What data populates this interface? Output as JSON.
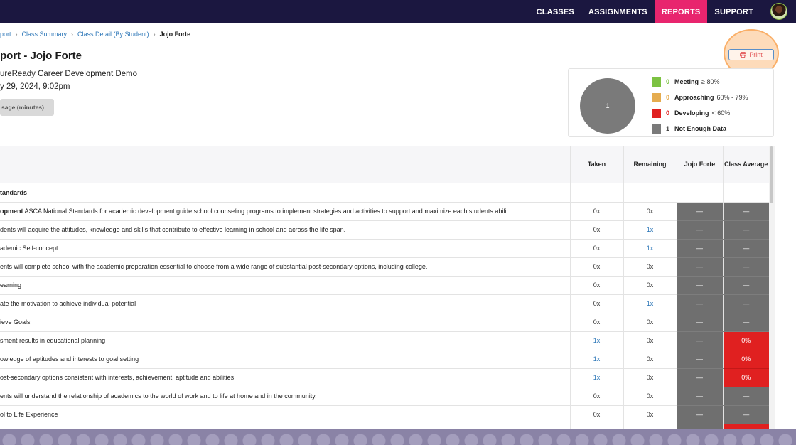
{
  "nav": {
    "items": [
      {
        "label": "CLASSES",
        "active": false
      },
      {
        "label": "ASSIGNMENTS",
        "active": false
      },
      {
        "label": "REPORTS",
        "active": true
      },
      {
        "label": "SUPPORT",
        "active": false
      }
    ],
    "active_color": "#e8256e",
    "bg_color": "#1b1740"
  },
  "breadcrumb": {
    "items": [
      "port",
      "Class Summary",
      "Class Detail (By Student)"
    ],
    "current": "Jojo Forte"
  },
  "header": {
    "title": "port - Jojo Forte",
    "course": "ureReady Career Development Demo",
    "date": "y 29, 2024, 9:02pm",
    "usage_button": "sage (minutes)"
  },
  "print_button": {
    "label": "Print"
  },
  "summary": {
    "pie_label": "1",
    "legend": [
      {
        "count": "0",
        "label": "Meeting",
        "range": "≥ 80%",
        "color": "#7cc242",
        "count_color": "#7cc242"
      },
      {
        "count": "0",
        "label": "Approaching",
        "range": "60% - 79%",
        "color": "#e5ac4f",
        "count_color": "#e5ac4f"
      },
      {
        "count": "0",
        "label": "Developing",
        "range": "< 60%",
        "color": "#e02020",
        "count_color": "#e02020"
      },
      {
        "count": "1",
        "label": "Not Enough Data",
        "range": "",
        "color": "#7a7a7a",
        "count_color": "#444444"
      }
    ]
  },
  "table": {
    "headers": [
      "Taken",
      "Remaining",
      "Jojo Forte",
      "Class Average"
    ],
    "section": "tandards",
    "rows": [
      {
        "bold": "opment",
        "text": " ASCA National Standards for academic development guide school counseling programs to implement strategies and activities to support and maximize each students abili...",
        "taken": "0x",
        "remaining": "0x",
        "student": "—",
        "average": "—",
        "taken_link": false,
        "remaining_link": false,
        "avg_red": false
      },
      {
        "bold": "",
        "text": "dents will acquire the attitudes, knowledge and skills that contribute to effective learning in school and across the life span.",
        "taken": "0x",
        "remaining": "1x",
        "student": "—",
        "average": "—",
        "taken_link": false,
        "remaining_link": true,
        "avg_red": false
      },
      {
        "bold": "",
        "text": "ademic Self-concept",
        "taken": "0x",
        "remaining": "1x",
        "student": "—",
        "average": "—",
        "taken_link": false,
        "remaining_link": true,
        "avg_red": false
      },
      {
        "bold": "",
        "text": "ents will complete school with the academic preparation essential to choose from a wide range of substantial post-secondary options, including college.",
        "taken": "0x",
        "remaining": "0x",
        "student": "—",
        "average": "—",
        "taken_link": false,
        "remaining_link": false,
        "avg_red": false
      },
      {
        "bold": "",
        "text": "earning",
        "taken": "0x",
        "remaining": "0x",
        "student": "—",
        "average": "—",
        "taken_link": false,
        "remaining_link": false,
        "avg_red": false
      },
      {
        "bold": "",
        "text": "ate the motivation to achieve individual potential",
        "taken": "0x",
        "remaining": "1x",
        "student": "—",
        "average": "—",
        "taken_link": false,
        "remaining_link": true,
        "avg_red": false
      },
      {
        "bold": "",
        "text": "ieve Goals",
        "taken": "0x",
        "remaining": "0x",
        "student": "—",
        "average": "—",
        "taken_link": false,
        "remaining_link": false,
        "avg_red": false
      },
      {
        "bold": "",
        "text": "sment results in educational planning",
        "taken": "1x",
        "remaining": "0x",
        "student": "—",
        "average": "0%",
        "taken_link": true,
        "remaining_link": false,
        "avg_red": true
      },
      {
        "bold": "",
        "text": "owledge of aptitudes and interests to goal setting",
        "taken": "1x",
        "remaining": "0x",
        "student": "—",
        "average": "0%",
        "taken_link": true,
        "remaining_link": false,
        "avg_red": true
      },
      {
        "bold": "",
        "text": "ost-secondary options consistent with interests, achievement, aptitude and abilities",
        "taken": "1x",
        "remaining": "0x",
        "student": "—",
        "average": "0%",
        "taken_link": true,
        "remaining_link": false,
        "avg_red": true
      },
      {
        "bold": "",
        "text": "ents will understand the relationship of academics to the world of work and to life at home and in the community.",
        "taken": "0x",
        "remaining": "0x",
        "student": "—",
        "average": "—",
        "taken_link": false,
        "remaining_link": false,
        "avg_red": false
      },
      {
        "bold": "",
        "text": "ol to Life Experience",
        "taken": "0x",
        "remaining": "0x",
        "student": "—",
        "average": "—",
        "taken_link": false,
        "remaining_link": false,
        "avg_red": false
      },
      {
        "bold": "",
        "text": "",
        "taken": "",
        "remaining": "",
        "student": "",
        "average": "",
        "taken_link": false,
        "remaining_link": false,
        "avg_red": true
      }
    ]
  }
}
